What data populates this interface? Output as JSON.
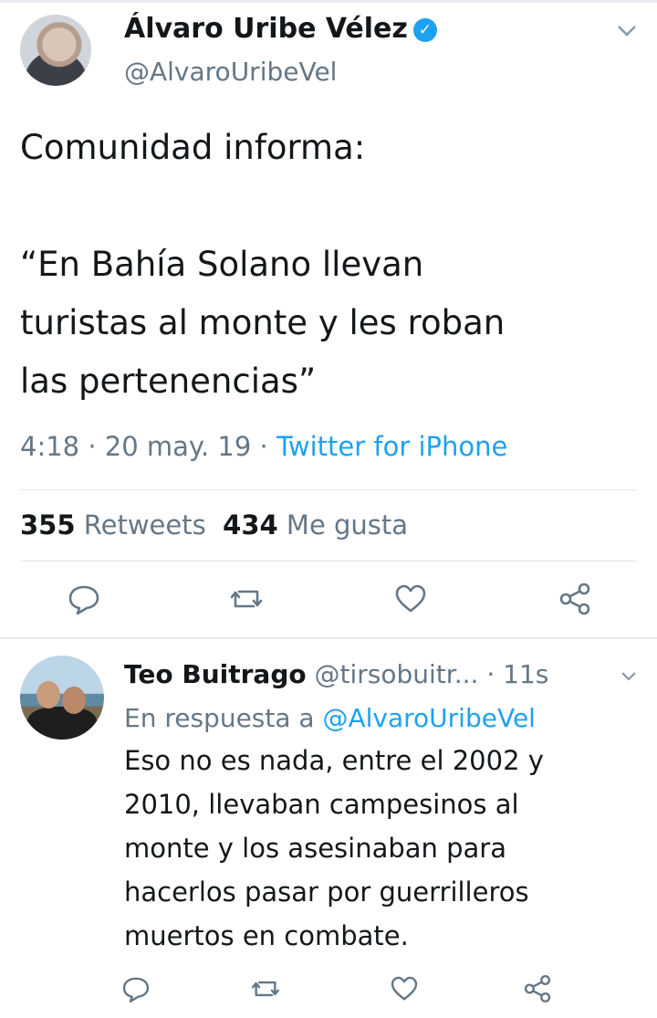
{
  "main_tweet": {
    "author_name": "Álvaro Uribe Vélez",
    "verified_mark": "✓",
    "handle": "@AlvaroUribeVel",
    "text_lines": [
      "Comunidad informa:",
      "“En Bahía Solano llevan",
      "turistas al monte y les roban",
      "las pertenencias”"
    ],
    "time": "4:18",
    "date": "20 may. 19",
    "source": "Twitter for iPhone",
    "separator": "·",
    "retweets_count": "355",
    "retweets_label": "Retweets",
    "likes_count": "434",
    "likes_label": "Me gusta"
  },
  "reply": {
    "author_name": "Teo Buitrago",
    "handle": "@tirsobuitr...",
    "time": "11s",
    "in_reply_prefix": "En respuesta a",
    "in_reply_handle": "@AlvaroUribeVel",
    "text_lines": [
      "Eso no es nada, entre el 2002 y",
      "2010, llevaban campesinos al",
      "monte y los asesinaban para",
      "hacerlos pasar por guerrilleros",
      "muertos en combate."
    ]
  },
  "icons": {
    "reply": "reply-icon",
    "retweet": "retweet-icon",
    "like": "heart-icon",
    "share": "share-icon",
    "menu": "chevron-down-icon"
  },
  "colors": {
    "accent": "#1da1f2",
    "secondary_text": "#657786",
    "icon_gray": "#657786",
    "divider": "#e1e8ed"
  }
}
